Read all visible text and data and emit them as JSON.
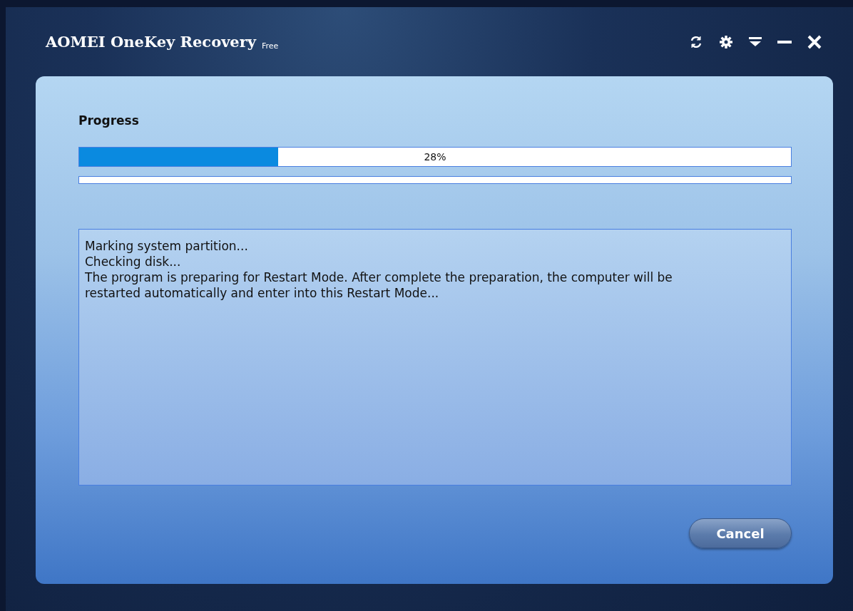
{
  "window": {
    "title": "AOMEI OneKey Recovery",
    "edition": "Free"
  },
  "progress": {
    "heading": "Progress",
    "level": 0.28,
    "reading": "28%"
  },
  "log": [
    "Marking system partition...",
    "Checking disk...",
    "The program is preparing for Restart Mode. After complete the preparation, the computer will be restarted automatically and enter into this Restart Mode..."
  ],
  "buttons": [
    "Cancel"
  ]
}
